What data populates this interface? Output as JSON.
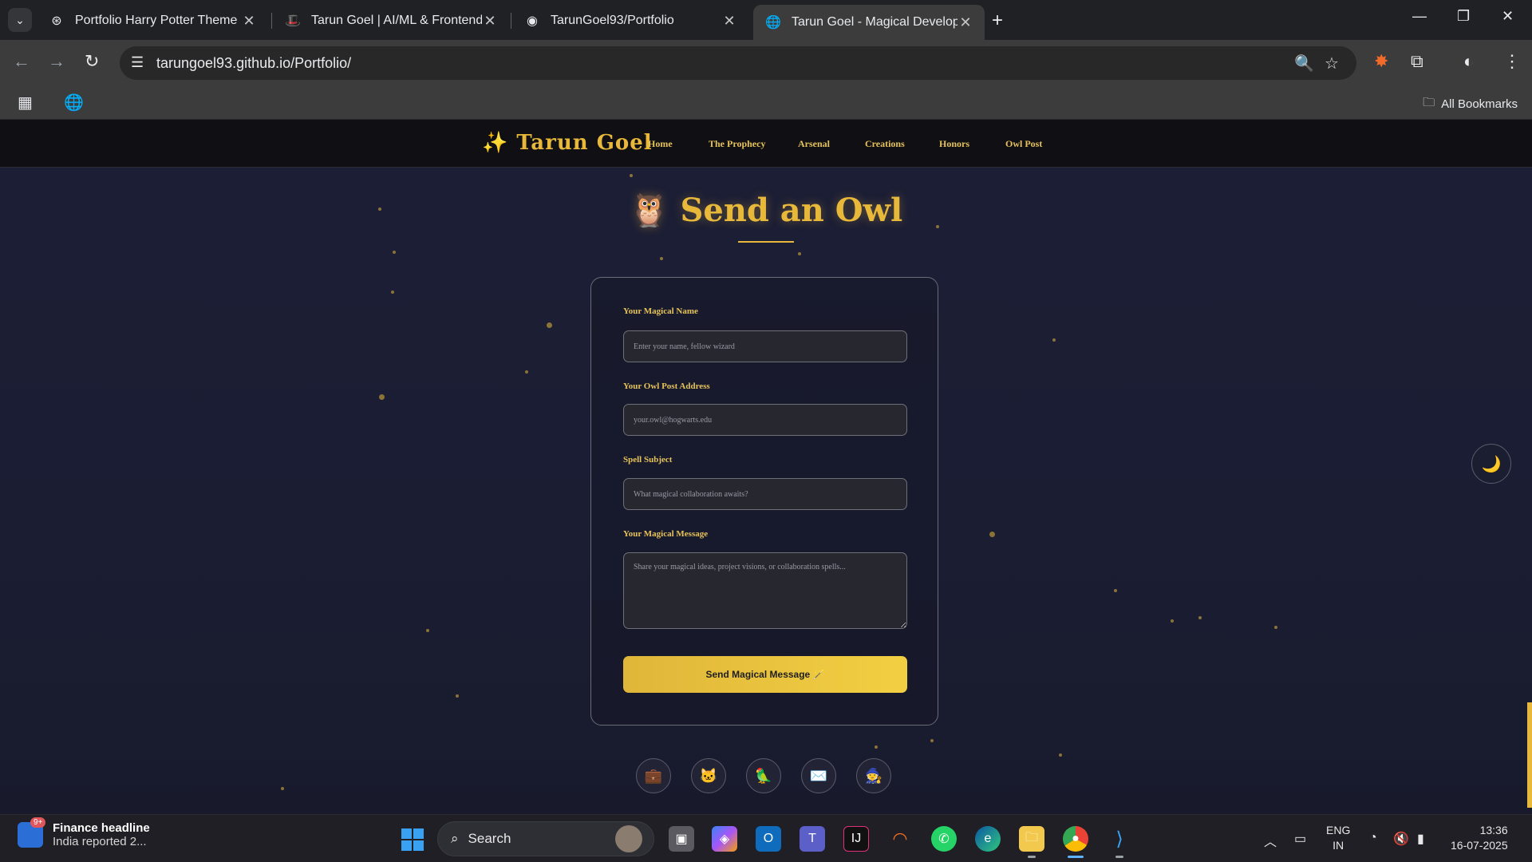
{
  "tabs": [
    {
      "title": "Portfolio Harry Potter Theme",
      "icon": "openai-icon"
    },
    {
      "title": "Tarun Goel | AI/ML & Frontend",
      "icon": "hat-icon"
    },
    {
      "title": "TarunGoel93/Portfolio",
      "icon": "github-icon"
    },
    {
      "title": "Tarun Goel - Magical Developer",
      "icon": "globe-icon",
      "active": true
    }
  ],
  "address": {
    "url": "tarungoel93.github.io/Portfolio/"
  },
  "bookmarks": {
    "all_label": "All Bookmarks"
  },
  "site": {
    "brand": "✨ Tarun Goel",
    "nav": [
      "Home",
      "The Prophecy",
      "Arsenal",
      "Creations",
      "Honors",
      "Owl Post"
    ]
  },
  "contact": {
    "title": "🦉 Send an Owl",
    "fields": [
      {
        "label": "Your Magical Name",
        "placeholder": "Enter your name, fellow wizard"
      },
      {
        "label": "Your Owl Post Address",
        "placeholder": "your.owl@hogwarts.edu"
      },
      {
        "label": "Spell Subject",
        "placeholder": "What magical collaboration awaits?"
      },
      {
        "label": "Your Magical Message",
        "placeholder": "Share your magical ideas, project visions, or collaboration spells..."
      }
    ],
    "submit": "Send Magical Message 🪄",
    "socials": [
      "💼",
      "🐱",
      "🦜",
      "✉️",
      "🧙"
    ],
    "theme_toggle": "🌙"
  },
  "taskbar": {
    "news_badge": "9+",
    "news_title": "Finance headline",
    "news_sub": "India reported 2...",
    "search_placeholder": "Search",
    "lang_line1": "ENG",
    "lang_line2": "IN",
    "time": "13:36",
    "date": "16-07-2025"
  },
  "colors": {
    "accent": "#e8b83a",
    "page_bg": "#1c1e36",
    "browser_bg": "#3c3c3c"
  }
}
